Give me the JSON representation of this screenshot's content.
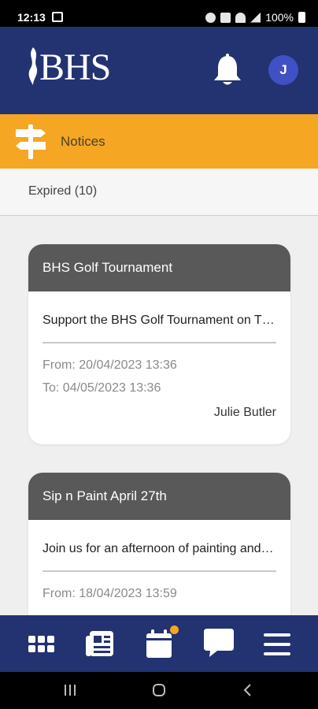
{
  "status_bar": {
    "time": "12:13",
    "battery": "100%",
    "icons": [
      "image-icon",
      "alarm-icon",
      "mute-icon",
      "wifi-icon",
      "signal-icon",
      "battery-icon"
    ]
  },
  "header": {
    "logo_text": "BHS",
    "bell_icon": "bell-icon",
    "avatar_initial": "J",
    "colors": {
      "background": "#233271",
      "avatar": "#3f51c4"
    }
  },
  "section": {
    "icon": "signpost-icon",
    "title": "Notices",
    "color": "#f5a623"
  },
  "tab": {
    "label": "Expired (10)"
  },
  "notices": [
    {
      "title": "BHS Golf Tournament",
      "description": "Support the BHS Golf Tournament on Thursday...",
      "from": "From: 20/04/2023 13:36",
      "to": "To: 04/05/2023 13:36",
      "author": "Julie Butler"
    },
    {
      "title": "Sip n Paint April 27th",
      "description": "Join us for an afternoon of painting and sipping...",
      "from": "From: 18/04/2023 13:59"
    }
  ],
  "bottom_nav": {
    "items": [
      "apps-grid-icon",
      "newspaper-icon",
      "calendar-icon",
      "chat-icon",
      "menu-icon"
    ],
    "badge_color": "#f5a623"
  },
  "system_nav": [
    "recents-icon",
    "home-icon",
    "back-icon"
  ]
}
